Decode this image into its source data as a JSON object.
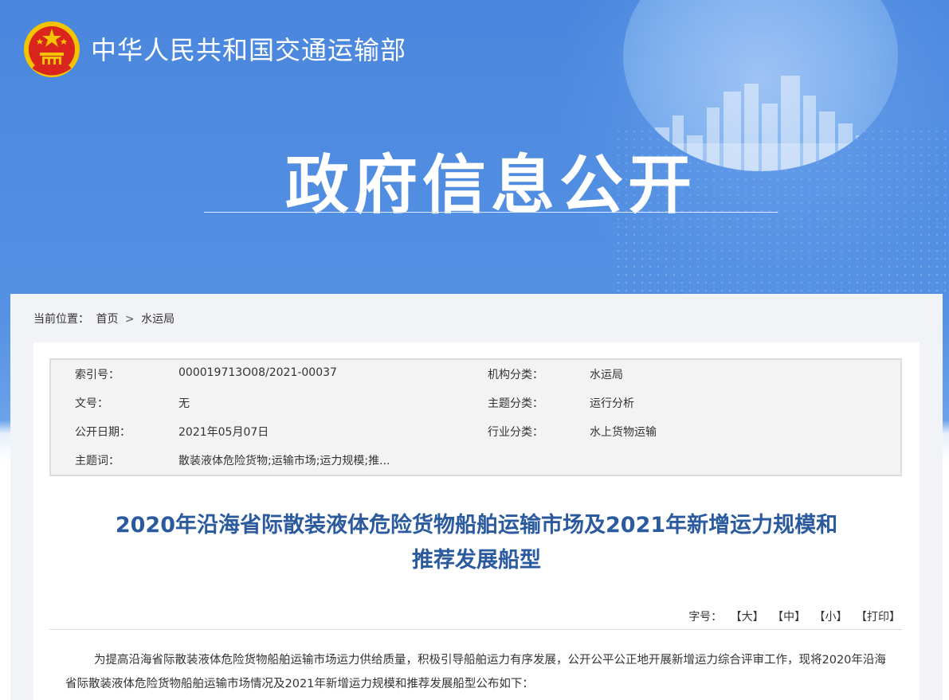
{
  "header": {
    "ministry_name": "中华人民共和国交通运输部",
    "banner_title": "政府信息公开",
    "emblem_icon": "national-emblem-icon"
  },
  "breadcrumb": {
    "label": "当前位置：",
    "home": "首页",
    "separator": ">",
    "current": "水运局"
  },
  "meta": {
    "rows": [
      {
        "k1": "索引号：",
        "v1": "000019713O08/2021-00037",
        "k2": "机构分类：",
        "v2": "水运局"
      },
      {
        "k1": "文号：",
        "v1": "无",
        "k2": "主题分类：",
        "v2": "运行分析"
      },
      {
        "k1": "公开日期：",
        "v1": "2021年05月07日",
        "k2": "行业分类：",
        "v2": "水上货物运输"
      },
      {
        "k1": "主题词：",
        "v1": "散装液体危险货物;运输市场;运力规模;推...",
        "k2": "",
        "v2": ""
      }
    ]
  },
  "document": {
    "title_line1": "2020年沿海省际散装液体危险货物船舶运输市场及2021年新增运力规模和",
    "title_line2": "推荐发展船型",
    "font_size_label": "字号：",
    "font_large": "【大】",
    "font_medium": "【中】",
    "font_small": "【小】",
    "print": "【打印】",
    "body": "为提高沿海省际散装液体危险货物船舶运输市场运力供给质量，积极引导船舶运力有序发展，公开公平公正地开展新增运力综合评审工作，现将2020年沿海省际散装液体危险货物船舶运输市场情况及2021年新增运力规模和推荐发展船型公布如下："
  },
  "colors": {
    "banner_blue": "#4a86dd",
    "title_blue": "#2b5b9e",
    "emblem_red": "#d9251d",
    "emblem_gold": "#f5c400"
  }
}
